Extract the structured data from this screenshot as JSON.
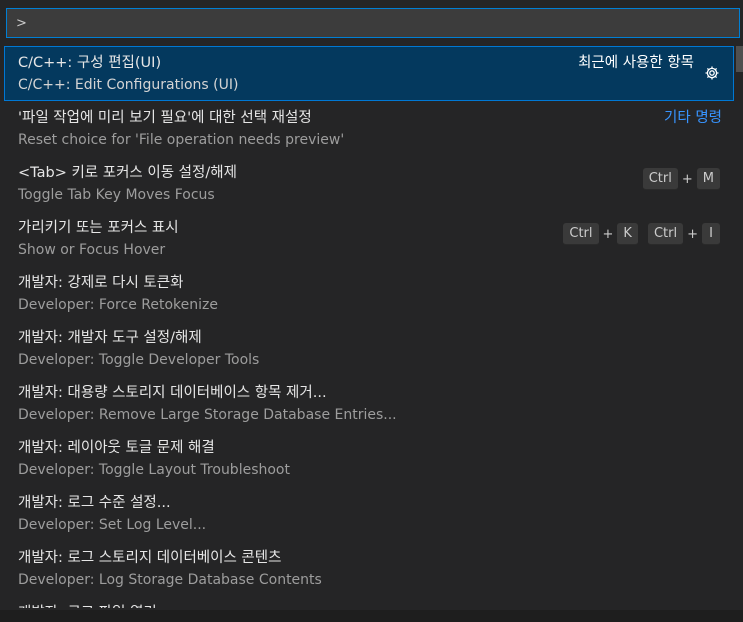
{
  "input": {
    "value": ">"
  },
  "items": [
    {
      "label": "C/C++: 구성 편집(UI)",
      "detail": "C/C++: Edit Configurations (UI)",
      "group": "최근에 사용한 항목",
      "selected": true
    },
    {
      "label": "'파일 작업에 미리 보기 필요'에 대한 선택 재설정",
      "detail": "Reset choice for 'File operation needs preview'",
      "group": "기타 명령"
    },
    {
      "label": "<Tab> 키로 포커스 이동 설정/해제",
      "detail": "Toggle Tab Key Moves Focus",
      "keys": [
        [
          "Ctrl",
          "M"
        ]
      ]
    },
    {
      "label": "가리키기 또는 포커스 표시",
      "detail": "Show or Focus Hover",
      "keys": [
        [
          "Ctrl",
          "K"
        ],
        [
          "Ctrl",
          "I"
        ]
      ]
    },
    {
      "label": "개발자: 강제로 다시 토큰화",
      "detail": "Developer: Force Retokenize"
    },
    {
      "label": "개발자: 개발자 도구 설정/해제",
      "detail": "Developer: Toggle Developer Tools"
    },
    {
      "label": "개발자: 대용량 스토리지 데이터베이스 항목 제거...",
      "detail": "Developer: Remove Large Storage Database Entries..."
    },
    {
      "label": "개발자: 레이아웃 토글 문제 해결",
      "detail": "Developer: Toggle Layout Troubleshoot"
    },
    {
      "label": "개발자: 로그 수준 설정...",
      "detail": "Developer: Set Log Level..."
    },
    {
      "label": "개발자: 로그 스토리지 데이터베이스 콘텐츠",
      "detail": "Developer: Log Storage Database Contents"
    },
    {
      "label": "개발자: 로그 파일 열기...",
      "detail": ""
    }
  ],
  "colors": {
    "accent": "#007fd4",
    "selected_bg": "#04395e",
    "group_label": "#3794ff",
    "background": "#252526"
  },
  "icons": {
    "configure": "gear-icon"
  }
}
